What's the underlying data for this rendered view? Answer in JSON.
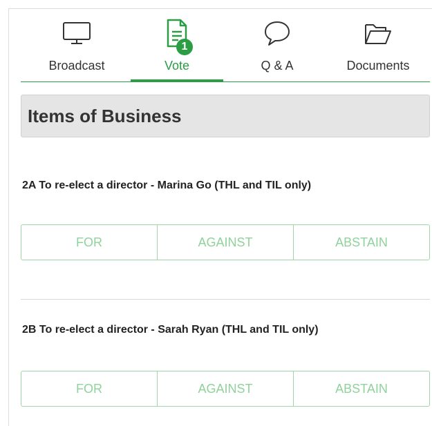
{
  "tabs": [
    {
      "label": "Broadcast",
      "icon": "monitor-icon",
      "active": false
    },
    {
      "label": "Vote",
      "icon": "document-icon",
      "active": true,
      "badge": "1"
    },
    {
      "label": "Q & A",
      "icon": "speech-bubble-icon",
      "active": false
    },
    {
      "label": "Documents",
      "icon": "folder-icon",
      "active": false
    }
  ],
  "section": {
    "title": "Items of Business"
  },
  "items": [
    {
      "title": "2A  To re-elect a director - Marina Go (THL and TIL only)",
      "options": [
        "FOR",
        "AGAINST",
        "ABSTAIN"
      ]
    },
    {
      "title": "2B  To re-elect a director - Sarah Ryan (THL and TIL only)",
      "options": [
        "FOR",
        "AGAINST",
        "ABSTAIN"
      ]
    }
  ],
  "colors": {
    "accent": "#2a9d45",
    "button_text": "#8fd29a",
    "button_border": "#9fd6a7",
    "header_bg": "#e5e5e5"
  }
}
